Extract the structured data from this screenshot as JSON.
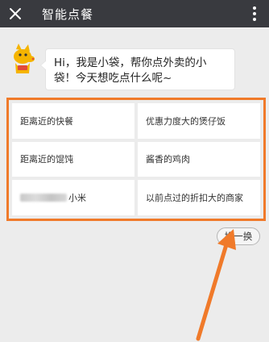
{
  "header": {
    "title": "智能点餐",
    "background": "#393a3f"
  },
  "chat": {
    "bot_message": "Hi，我是小袋，帮你点外卖的小袋！今天想吃点什么呢~"
  },
  "options": [
    {
      "label": "距离近的快餐"
    },
    {
      "label": "优惠力度大的煲仔饭"
    },
    {
      "label": "距离近的馄饨"
    },
    {
      "label": "酱香的鸡肉"
    },
    {
      "label": "小米",
      "blurred_prefix": true
    },
    {
      "label": "以前点过的折扣大的商家"
    }
  ],
  "refresh_label": "换一换",
  "colors": {
    "annotation": "#f07a2a",
    "page_bg": "#ececec"
  },
  "icons": {
    "close": "close-icon",
    "more": "more-vertical-icon",
    "avatar": "kangaroo-avatar-icon"
  }
}
